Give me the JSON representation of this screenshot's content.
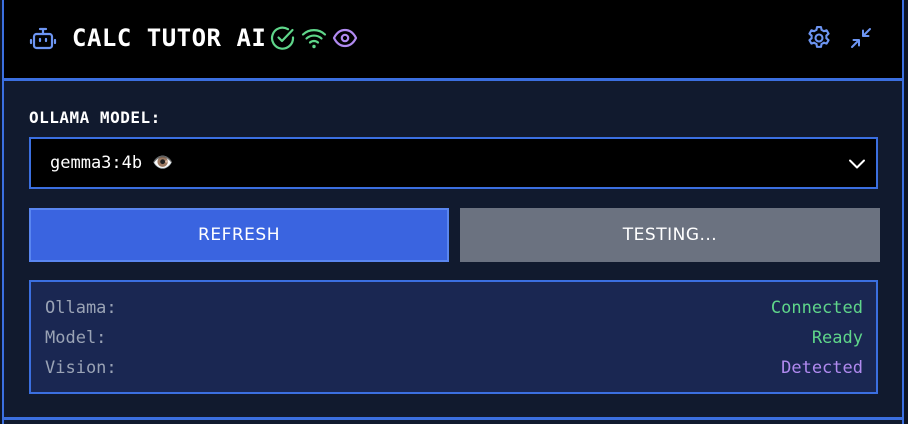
{
  "header": {
    "title": "CALC TUTOR AI",
    "icons": [
      "robot-icon",
      "check-circle-icon",
      "wifi-icon",
      "eye-icon",
      "gear-icon",
      "minimize-icon"
    ]
  },
  "model": {
    "label": "OLLAMA MODEL:",
    "selected": "gemma3:4b 👁️"
  },
  "buttons": {
    "refresh": "REFRESH",
    "testing": "TESTING..."
  },
  "status": {
    "rows": [
      {
        "key": "Ollama:",
        "value": "Connected"
      },
      {
        "key": "Model:",
        "value": "Ready"
      },
      {
        "key": "Vision:",
        "value": "Detected"
      }
    ]
  },
  "colors": {
    "accent": "#3b6fe0",
    "success": "#5fd68a",
    "vision": "#b18af0",
    "button_primary": "#3a64e0",
    "button_disabled": "#6b7280"
  }
}
